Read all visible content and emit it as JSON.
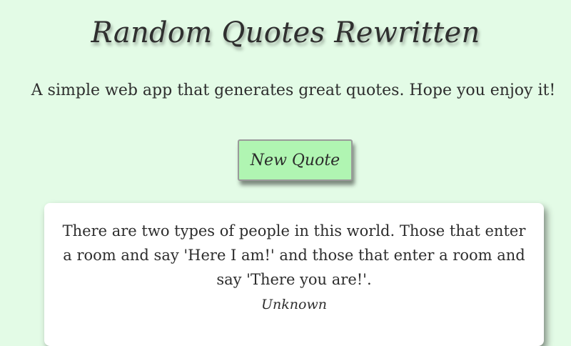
{
  "header": {
    "title": "Random Quotes Rewritten",
    "subtitle": "A simple web app that generates great quotes. Hope you enjoy it!"
  },
  "controls": {
    "new_quote_label": "New Quote"
  },
  "quote": {
    "text": "There are two types of people in this world. Those that enter a room and say 'Here I am!' and those that enter a room and say 'There you are!'.",
    "author": "Unknown"
  },
  "colors": {
    "background": "#e3fbe6",
    "button": "#b0f5b2",
    "card": "#ffffff",
    "text": "#2d2d2d"
  }
}
